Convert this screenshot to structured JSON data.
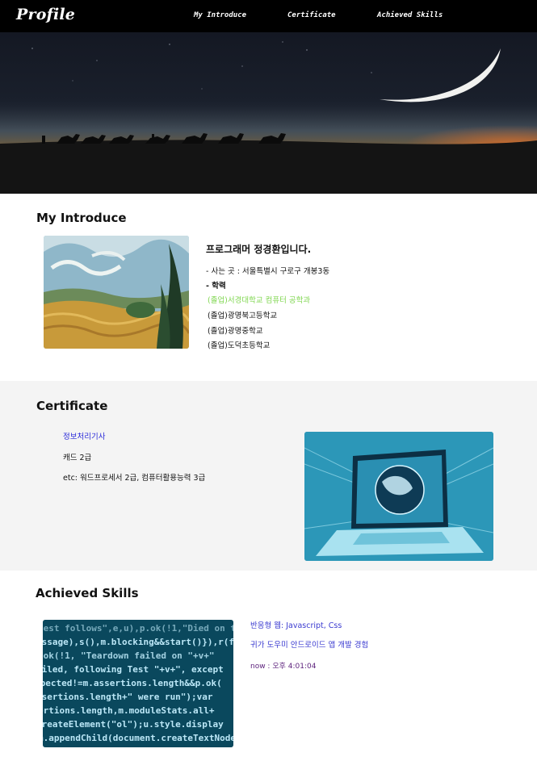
{
  "header": {
    "logo": "Profile",
    "nav": [
      "My Introduce",
      "Certificate",
      "Achieved Skills"
    ]
  },
  "intro": {
    "title": "My Introduce",
    "heading": "프로그래머 정경환입니다.",
    "lines": [
      "- 사는 곳 : 서울특별시 구로구 개봉3동",
      "- 학력",
      "(졸업)서경대학교 컴퓨터 공학과",
      "(졸업)광명북고등학교",
      "(졸업)광명중학교",
      "(졸업)도덕초등학교"
    ],
    "highlight_color": "#7fd64f"
  },
  "certificate": {
    "title": "Certificate",
    "items": [
      "정보처리기사",
      "캐드 2급",
      "etc: 워드프로세서 2급, 컴퓨터활용능력 3급"
    ],
    "link_color": "#2b2bd9"
  },
  "skills": {
    "title": "Achieved Skills",
    "items": [
      "반응형 웹: Javascript, Css",
      "귀가 도우미 안드로이드 앱 개발 경험"
    ],
    "now_label": "now : ",
    "time": "오후 4:01:04",
    "link_color": "#3a3ad0",
    "time_color": "#5a1e7a"
  }
}
